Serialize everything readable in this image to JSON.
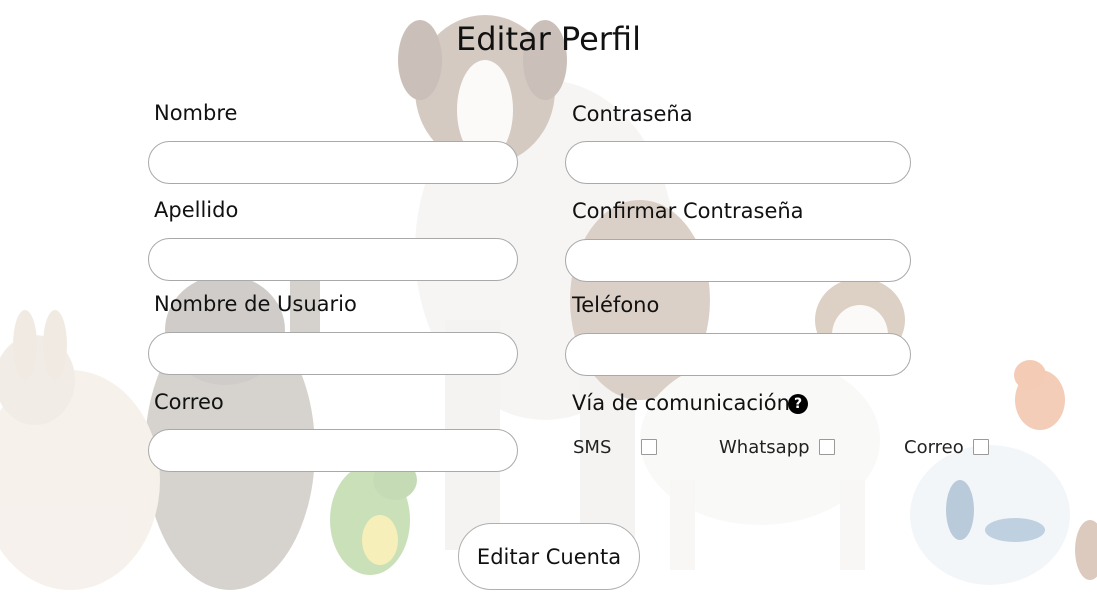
{
  "page": {
    "title": "Editar Perfil"
  },
  "form": {
    "left": [
      {
        "label": "Nombre",
        "value": "",
        "placeholder": ""
      },
      {
        "label": "Apellido",
        "value": "",
        "placeholder": ""
      },
      {
        "label": "Nombre de Usuario",
        "value": "",
        "placeholder": ""
      },
      {
        "label": "Correo",
        "value": "",
        "placeholder": ""
      }
    ],
    "right": [
      {
        "label": "Contraseña",
        "value": "",
        "placeholder": ""
      },
      {
        "label": "Confirmar Contraseña",
        "value": "",
        "placeholder": ""
      },
      {
        "label": "Teléfono",
        "value": "",
        "placeholder": ""
      }
    ],
    "communication": {
      "label": "Vía de comunicación",
      "help_icon": "question-circle-icon",
      "options": [
        {
          "label": "SMS",
          "checked": false
        },
        {
          "label": "Whatsapp",
          "checked": false
        },
        {
          "label": "Correo",
          "checked": false
        }
      ]
    },
    "submit_label": "Editar Cuenta"
  },
  "background": {
    "description_icon": "pets-background-image"
  }
}
